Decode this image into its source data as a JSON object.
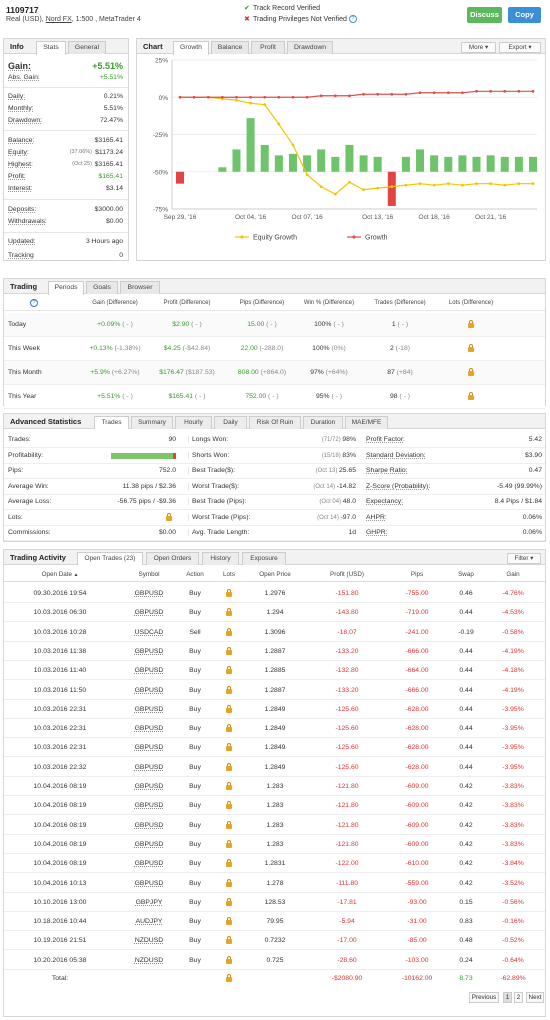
{
  "header": {
    "account_number": "1109717",
    "account_type": "Real (USD),",
    "broker": "Nord FX",
    "leverage_platform": ", 1:500 , MetaTrader 4",
    "verified_1": "Track Record Verified",
    "verified_2": "Trading Privileges Not Verified",
    "discuss_label": "Discuss",
    "copy_label": "Copy",
    "check_icon": "check-icon",
    "cross_icon": "cross-icon",
    "info_icon": "info-icon"
  },
  "info": {
    "title": "Info",
    "tabs": [
      "Stats",
      "General"
    ],
    "gain_label": "Gain:",
    "gain_value": "+5.51%",
    "abs_gain_label": "Abs. Gain:",
    "abs_gain_value": "+5.51%",
    "rows1": [
      {
        "label": "Daily:",
        "value": "0.21%"
      },
      {
        "label": "Monthly:",
        "value": "5.51%"
      },
      {
        "label": "Drawdown:",
        "value": "72.47%"
      }
    ],
    "rows2": [
      {
        "label": "Balance:",
        "note": "",
        "value": "$3165.41"
      },
      {
        "label": "Equity:",
        "note": "(37.06%)",
        "value": "$1173.24"
      },
      {
        "label": "Highest:",
        "note": "(Oct 25)",
        "value": "$3165.41"
      },
      {
        "label": "Profit:",
        "note": "",
        "value": "$165.41"
      },
      {
        "label": "Interest:",
        "note": "",
        "value": "$3.14"
      }
    ],
    "rows3": [
      {
        "label": "Deposits:",
        "value": "$3000.00"
      },
      {
        "label": "Withdrawals:",
        "value": "$0.00"
      }
    ],
    "rows4": [
      {
        "label": "Updated:",
        "value": "3 Hours ago"
      },
      {
        "label": "Tracking",
        "value": "0"
      }
    ]
  },
  "chart_panel": {
    "title": "Chart",
    "tabs": [
      "Growth",
      "Balance",
      "Profit",
      "Drawdown"
    ],
    "more_label": "More",
    "export_label": "Export"
  },
  "chart_data": {
    "type": "line",
    "x": [
      "Sep 29, '16",
      "Oct 04, '16",
      "Oct 07, '16",
      "Oct 13, '16",
      "Oct 18, '16",
      "Oct 21, '16"
    ],
    "y_ticks": [
      "25%",
      "0%",
      "-25%",
      "-50%",
      "-75%"
    ],
    "ylim": [
      -75,
      25
    ],
    "series": [
      {
        "name": "Equity Growth",
        "color": "#f5c400",
        "values": [
          0,
          0,
          0,
          -1,
          -2,
          -4,
          -5,
          -18,
          -32,
          -52,
          -60,
          -65,
          -57,
          -62,
          -61,
          -60,
          -59,
          -58,
          -59,
          -58,
          -59,
          -58,
          -58,
          -59,
          -58,
          -58
        ]
      },
      {
        "name": "Growth",
        "color": "#d9534f",
        "values": [
          0,
          0,
          0,
          0,
          0,
          0,
          0,
          0,
          0,
          0,
          1,
          1,
          1,
          2,
          2,
          2,
          2,
          3,
          3,
          3,
          3,
          4,
          4,
          4,
          4,
          4
        ]
      }
    ],
    "bars": [
      -8,
      0,
      0,
      -3,
      -15,
      -36,
      -18,
      -11,
      -12,
      -11,
      -15,
      -10,
      -18,
      -11,
      -10,
      -27,
      -10,
      -15,
      -11,
      -10,
      -11,
      -10,
      -11,
      -10,
      -10,
      -10
    ],
    "bar_colors_neg_red": [
      0,
      15
    ],
    "legend": [
      "Equity Growth",
      "Growth"
    ]
  },
  "trading": {
    "title": "Trading",
    "tabs": [
      "Periods",
      "Goals",
      "Browser"
    ],
    "headers": [
      "Gain (Difference)",
      "Profit (Difference)",
      "Pips (Difference)",
      "Win % (Difference)",
      "Trades (Difference)",
      "Lots (Difference)"
    ],
    "rows": [
      {
        "label": "Today",
        "gain": "+0.09%",
        "gain_diff": "( - )",
        "profit": "$2.90",
        "profit_diff": "( - )",
        "pips": "15.00",
        "pips_diff": "( - )",
        "win": "100%",
        "win_diff": "( - )",
        "trades": "1",
        "trades_diff": "( - )"
      },
      {
        "label": "This Week",
        "gain": "+0.13%",
        "gain_diff": "(-1.38%)",
        "profit": "$4.25",
        "profit_diff": "(-$42.84)",
        "pips": "22.00",
        "pips_diff": "(-288.0)",
        "win": "100%",
        "win_diff": "(0%)",
        "trades": "2",
        "trades_diff": "(-18)"
      },
      {
        "label": "This Month",
        "gain": "+5.9%",
        "gain_diff": "(+6.27%)",
        "profit": "$176.47",
        "profit_diff": "($187.53)",
        "pips": "808.00",
        "pips_diff": "(+864.0)",
        "win": "97%",
        "win_diff": "(+64%)",
        "trades": "87",
        "trades_diff": "(+84)"
      },
      {
        "label": "This Year",
        "gain": "+5.51%",
        "gain_diff": "( - )",
        "profit": "$165.41",
        "profit_diff": "( - )",
        "pips": "752.00",
        "pips_diff": "( - )",
        "win": "95%",
        "win_diff": "( - )",
        "trades": "98",
        "trades_diff": "( - )"
      }
    ]
  },
  "adv": {
    "title": "Advanced Statistics",
    "tabs": [
      "Trades",
      "Summary",
      "Hourly",
      "Daily",
      "Risk Of Ruin",
      "Duration",
      "MAE/MFE"
    ],
    "col1": [
      {
        "label": "Trades:",
        "value": "90"
      },
      {
        "label": "Profitability:",
        "value": ""
      },
      {
        "label": "Pips:",
        "value": "752.0"
      },
      {
        "label": "Average Win:",
        "value": "11.38 pips / $2.36"
      },
      {
        "label": "Average Loss:",
        "value": "-56.75 pips / -$9.36"
      },
      {
        "label": "Lots:",
        "value": ""
      },
      {
        "label": "Commissions:",
        "value": "$0.00"
      }
    ],
    "col2": [
      {
        "label": "Longs Won:",
        "note": "(71/72)",
        "value": "98%"
      },
      {
        "label": "Shorts Won:",
        "note": "(15/18)",
        "value": "83%"
      },
      {
        "label": "Best Trade($):",
        "note": "(Oct 13)",
        "value": "25.65"
      },
      {
        "label": "Worst Trade($):",
        "note": "(Oct 14)",
        "value": "-14.82"
      },
      {
        "label": "Best Trade (Pips):",
        "note": "(Oct 04)",
        "value": "48.0"
      },
      {
        "label": "Worst Trade (Pips):",
        "note": "(Oct 14)",
        "value": "-97.0"
      },
      {
        "label": "Avg. Trade Length:",
        "note": "",
        "value": "1d"
      }
    ],
    "col3": [
      {
        "label": "Profit Factor:",
        "value": "5.42"
      },
      {
        "label": "Standard Deviation:",
        "value": "$3.90"
      },
      {
        "label": "Sharpe Ratio:",
        "value": "0.47"
      },
      {
        "label": "Z-Score (Probability):",
        "value": "-5.49 (99.99%)"
      },
      {
        "label": "Expectancy:",
        "value": "8.4 Pips / $1.84"
      },
      {
        "label": "AHPR:",
        "value": "0.06%"
      },
      {
        "label": "GHPR:",
        "value": "0.06%"
      }
    ],
    "profitability": 0.95
  },
  "activity": {
    "title": "Trading Activity",
    "tabs": [
      "Open Trades (23)",
      "Open Orders",
      "History",
      "Exposure"
    ],
    "filter_label": "Filter",
    "headers": [
      "Open Date",
      "Symbol",
      "Action",
      "Lots",
      "Open Price",
      "Profit (USD)",
      "Pips",
      "Swap",
      "Gain"
    ],
    "sort_icon": "sort-asc-icon",
    "rows": [
      [
        "09.30.2016 19:54",
        "GBPUSD",
        "Buy",
        "1.2976",
        "-151.80",
        "-755.00",
        "0.46",
        "-4.76%"
      ],
      [
        "10.03.2016 06:30",
        "GBPUSD",
        "Buy",
        "1.294",
        "-143.80",
        "-719.00",
        "0.44",
        "-4.53%"
      ],
      [
        "10.03.2016 10:28",
        "USDCAD",
        "Sell",
        "1.3096",
        "-18.07",
        "-241.00",
        "-0.19",
        "-0.58%"
      ],
      [
        "10.03.2016 11:38",
        "GBPUSD",
        "Buy",
        "1.2887",
        "-133.20",
        "-666.00",
        "0.44",
        "-4.19%"
      ],
      [
        "10.03.2016 11:40",
        "GBPUSD",
        "Buy",
        "1.2885",
        "-132.80",
        "-664.00",
        "0.44",
        "-4.18%"
      ],
      [
        "10.03.2016 11:50",
        "GBPUSD",
        "Buy",
        "1.2887",
        "-133.20",
        "-666.00",
        "0.44",
        "-4.19%"
      ],
      [
        "10.03.2016 22:31",
        "GBPUSD",
        "Buy",
        "1.2849",
        "-125.60",
        "-628.00",
        "0.44",
        "-3.95%"
      ],
      [
        "10.03.2016 22:31",
        "GBPUSD",
        "Buy",
        "1.2849",
        "-125.60",
        "-628.00",
        "0.44",
        "-3.95%"
      ],
      [
        "10.03.2016 22:31",
        "GBPUSD",
        "Buy",
        "1.2849",
        "-125.60",
        "-628.00",
        "0.44",
        "-3.95%"
      ],
      [
        "10.03.2016 22:32",
        "GBPUSD",
        "Buy",
        "1.2849",
        "-125.60",
        "-628.00",
        "0.44",
        "-3.95%"
      ],
      [
        "10.04.2016 08:19",
        "GBPUSD",
        "Buy",
        "1.283",
        "-121.80",
        "-609.00",
        "0.42",
        "-3.83%"
      ],
      [
        "10.04.2016 08:19",
        "GBPUSD",
        "Buy",
        "1.283",
        "-121.80",
        "-609.00",
        "0.42",
        "-3.83%"
      ],
      [
        "10.04.2016 08:19",
        "GBPUSD",
        "Buy",
        "1.283",
        "-121.80",
        "-609.00",
        "0.42",
        "-3.83%"
      ],
      [
        "10.04.2016 08:19",
        "GBPUSD",
        "Buy",
        "1.283",
        "-121.80",
        "-609.00",
        "0.42",
        "-3.83%"
      ],
      [
        "10.04.2016 08:19",
        "GBPUSD",
        "Buy",
        "1.2831",
        "-122.00",
        "-610.00",
        "0.42",
        "-3.84%"
      ],
      [
        "10.04.2016 10:13",
        "GBPUSD",
        "Buy",
        "1.278",
        "-111.80",
        "-559.00",
        "0.42",
        "-3.52%"
      ],
      [
        "10.10.2016 13:00",
        "GBPJPY",
        "Buy",
        "128.53",
        "-17.81",
        "-93.00",
        "0.15",
        "-0.56%"
      ],
      [
        "10.18.2016 10:44",
        "AUDJPY",
        "Buy",
        "79.95",
        "-5.94",
        "-31.00",
        "0.83",
        "-0.16%"
      ],
      [
        "10.19.2016 21:51",
        "NZDUSD",
        "Buy",
        "0.7232",
        "-17.00",
        "-85.00",
        "0.48",
        "-0.52%"
      ],
      [
        "10.20.2016 05:38",
        "NZDUSD",
        "Buy",
        "0.725",
        "-28.60",
        "-103.00",
        "0.24",
        "-0.64%"
      ]
    ],
    "total_label": "Total:",
    "total_profit": "-$2080.90",
    "total_pips": "-10162.00",
    "total_swap": "8.73",
    "total_gain": "-62.89%",
    "pager": [
      "Previous",
      "1",
      "2",
      "Next"
    ]
  }
}
